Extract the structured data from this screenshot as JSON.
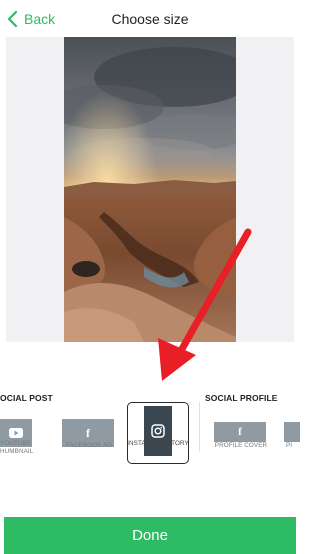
{
  "header": {
    "back_label": "Back",
    "title": "Choose size"
  },
  "colors": {
    "accent": "#2dbb63",
    "arrow": "#e81f26",
    "thumb": "#8f9aa3",
    "thumb_selected": "#3a4650"
  },
  "sections": {
    "social_post": "OCIAL POST",
    "social_profile": "SOCIAL PROFILE"
  },
  "options": [
    {
      "label_line1": "YOUTUBE",
      "label_line2": "HUMBNAIL",
      "icon": "youtube-icon"
    },
    {
      "label_line1": "FACEBOOK AD",
      "icon": "facebook-icon"
    },
    {
      "label_line1": "INSTAGRAM STORY",
      "icon": "instagram-icon",
      "selected": true
    },
    {
      "label_line1": "PROFILE COVER",
      "icon": "facebook-icon"
    },
    {
      "label_line1": "PI",
      "icon": ""
    }
  ],
  "done_label": "Done"
}
